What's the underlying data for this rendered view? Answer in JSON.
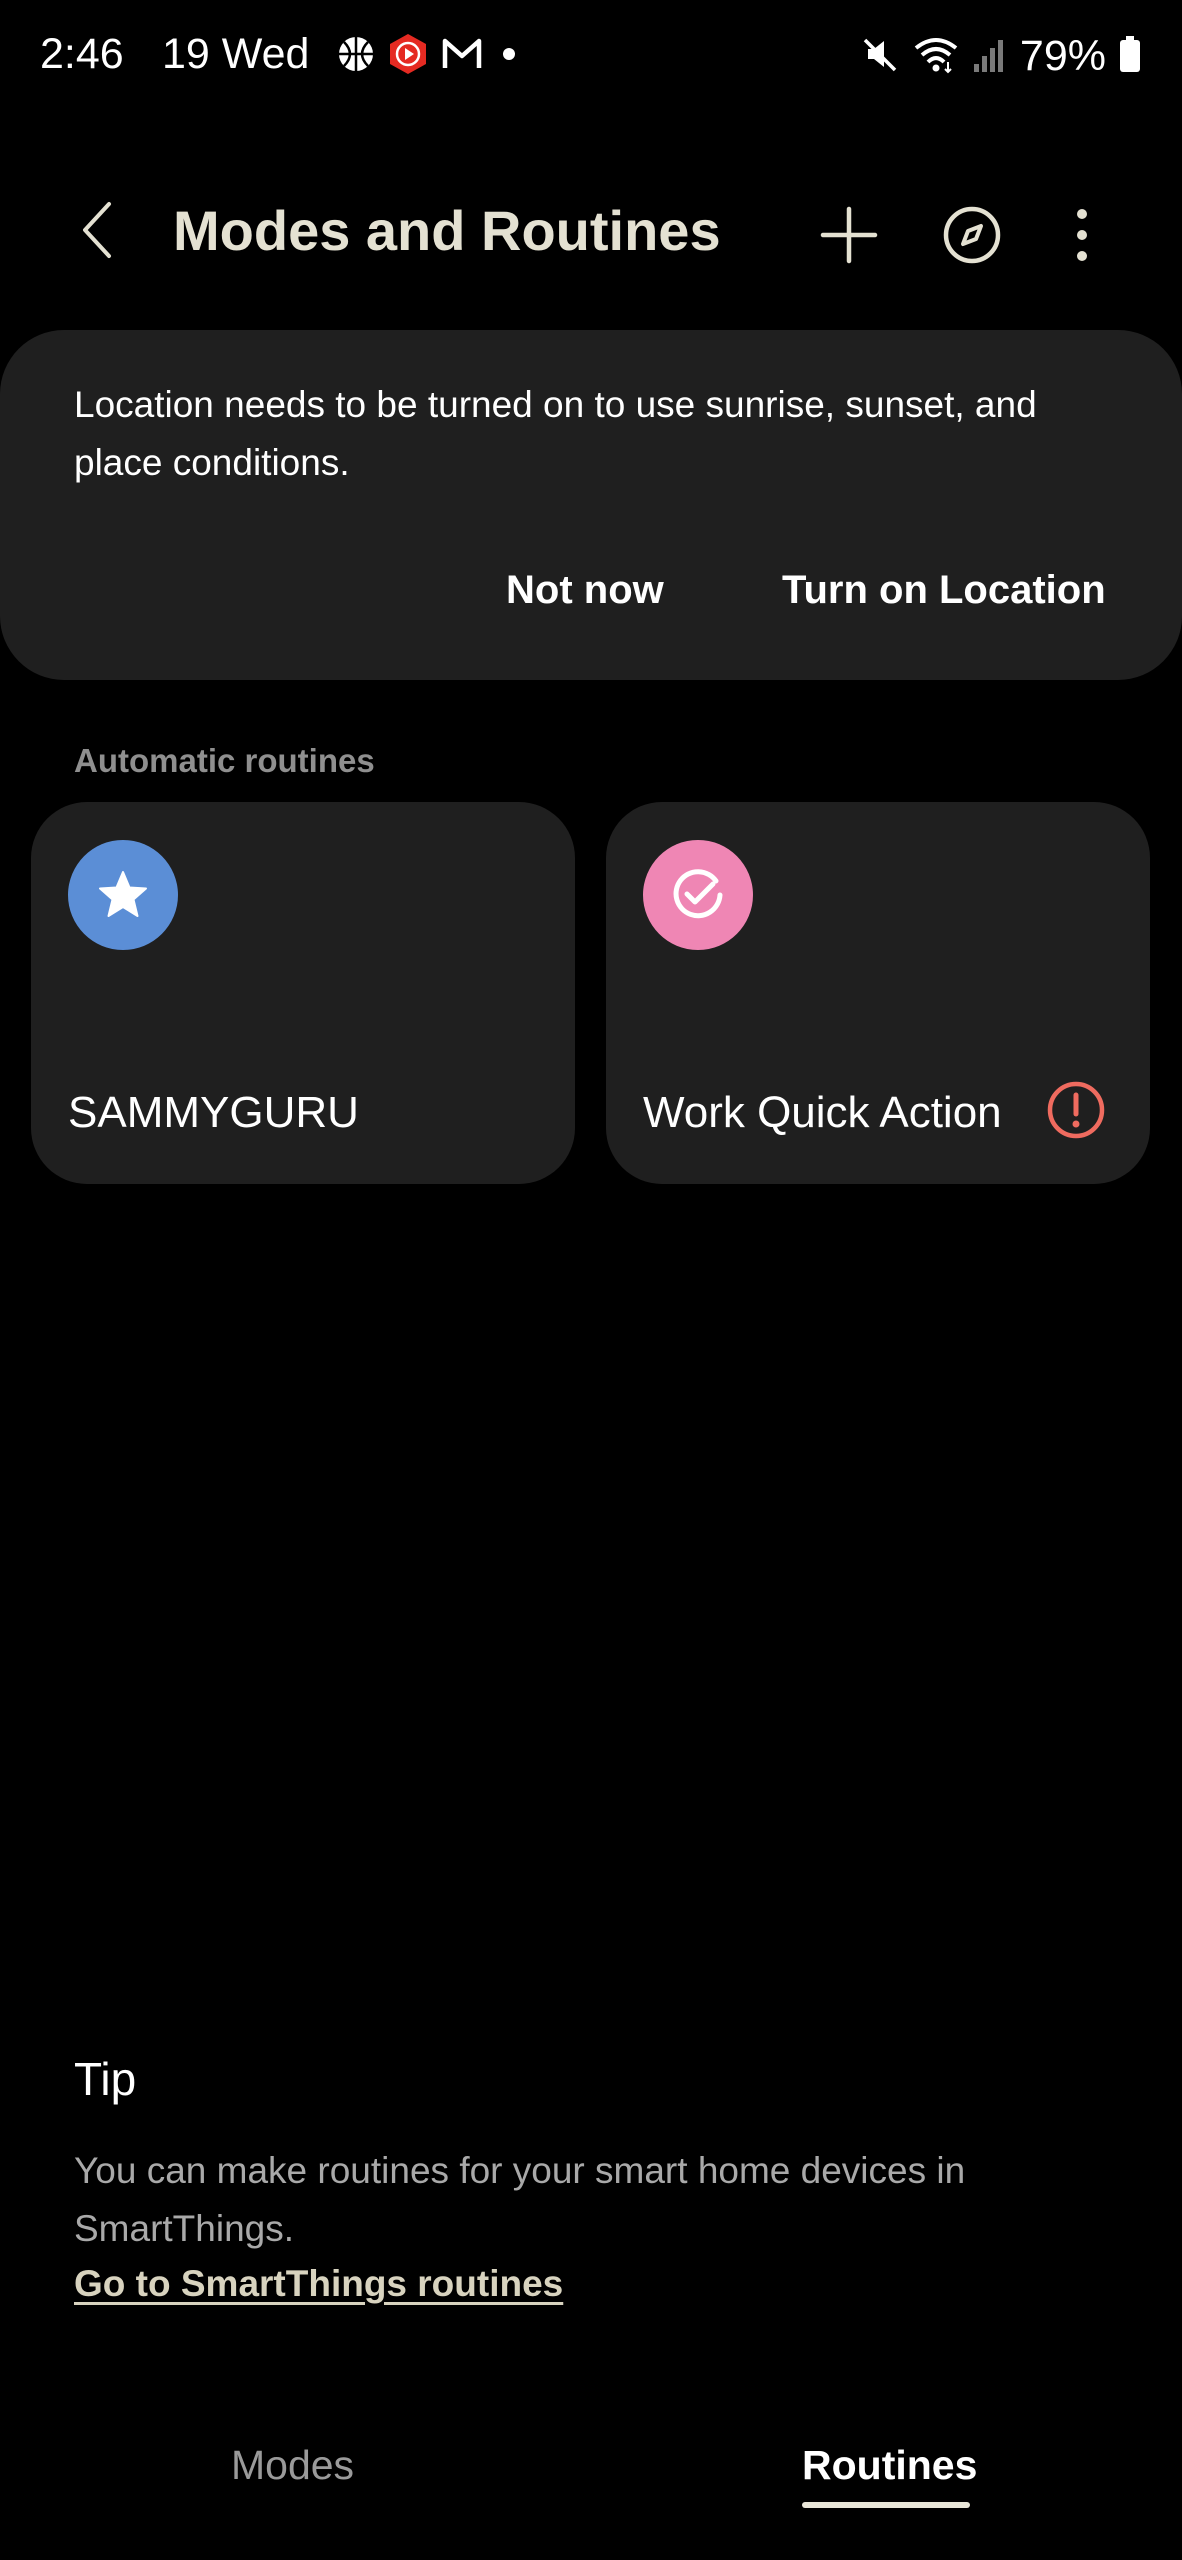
{
  "status_bar": {
    "time": "2:46",
    "date": "19 Wed",
    "battery": "79%",
    "left_icons": [
      "basketball-icon",
      "youtube-music-icon",
      "gmail-icon",
      "notification-dot-icon"
    ],
    "right_icons": [
      "mute-icon",
      "wifi-icon",
      "signal-icon",
      "battery-icon"
    ]
  },
  "header": {
    "title": "Modes and Routines",
    "icons": [
      "back-icon",
      "plus-icon",
      "compass-icon",
      "more-vert-icon"
    ]
  },
  "location_card": {
    "message": "Location needs to be turned on to use sunrise, sunset, and place conditions.",
    "not_now_label": "Not now",
    "turn_on_label": "Turn on Location"
  },
  "routines_section": {
    "header": "Automatic routines",
    "items": [
      {
        "label": "SAMMYGURU",
        "icon": "star-icon",
        "icon_color": "#5b8ed6",
        "warning": false
      },
      {
        "label": "Work Quick Action",
        "icon": "check-circle-icon",
        "icon_color": "#ef86b4",
        "warning": true,
        "warning_color": "#ef6b5f"
      }
    ]
  },
  "tip": {
    "title": "Tip",
    "text": "You can make routines for your smart home devices in SmartThings.",
    "link": "Go to SmartThings routines"
  },
  "bottom_tabs": {
    "modes_label": "Modes",
    "routines_label": "Routines",
    "selected": "Routines"
  },
  "colors": {
    "background": "#000000",
    "card": "#1f1f1f",
    "title": "#e4e1d2",
    "secondary_text": "#a9a9a9"
  }
}
